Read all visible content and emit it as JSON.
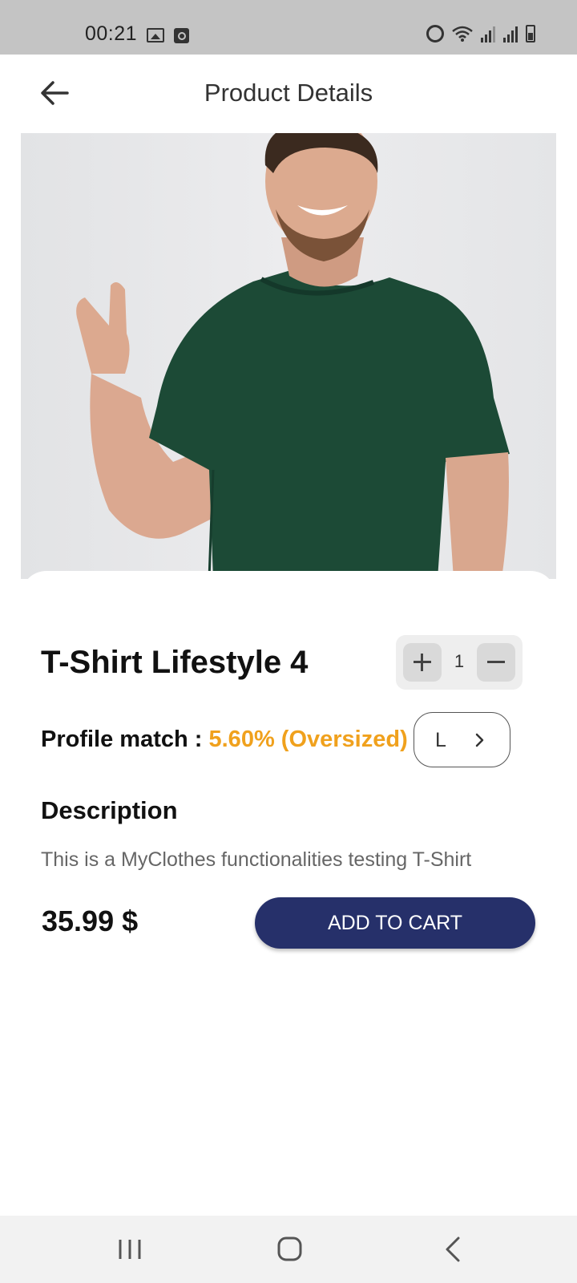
{
  "status_bar": {
    "time": "00:21",
    "icons": [
      "gallery-icon",
      "clock-app-icon",
      "alarm-icon",
      "wifi-icon",
      "signal-icon",
      "signal-icon",
      "battery-icon"
    ]
  },
  "app_bar": {
    "title": "Product Details",
    "back_icon": "arrow-left-icon"
  },
  "product": {
    "image_subject": "man in dark green t-shirt",
    "name": "T-Shirt Lifestyle 4",
    "quantity": "1",
    "profile_match_label": "Profile match : ",
    "profile_match_value": "5.60% (Oversized)",
    "size": "L",
    "description_heading": "Description",
    "description": "This is a MyClothes functionalities testing T-Shirt",
    "price": "35.99 $",
    "add_to_cart_label": "ADD TO CART"
  },
  "colors": {
    "accent_button": "#26306a",
    "match_highlight": "#f0a11d",
    "shirt": "#1c4a36",
    "status_bar": "#c4c4c4"
  },
  "nav_bar": {
    "icons": [
      "recents-icon",
      "home-icon",
      "back-icon"
    ]
  }
}
